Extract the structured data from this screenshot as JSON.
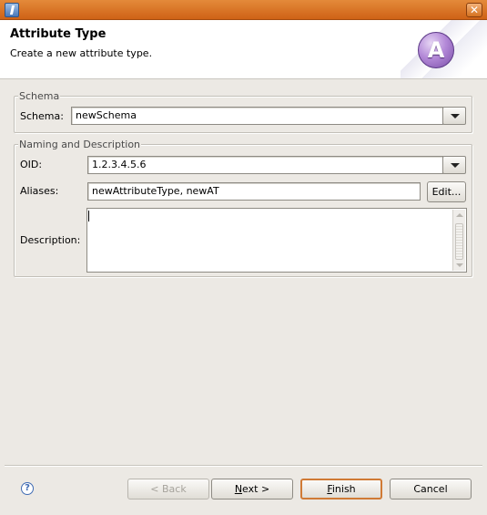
{
  "window": {
    "close_glyph": "✕"
  },
  "header": {
    "title": "Attribute Type",
    "description": "Create a new attribute type.",
    "badge_letter": "A"
  },
  "schema_group": {
    "legend": "Schema",
    "schema_label": "Schema:",
    "schema_value": "newSchema"
  },
  "naming_group": {
    "legend": "Naming and Description",
    "oid_label": "OID:",
    "oid_value": "1.2.3.4.5.6",
    "aliases_label": "Aliases:",
    "aliases_value": "newAttributeType, newAT",
    "edit_label": "Edit...",
    "description_label": "Description:",
    "description_value": ""
  },
  "footer": {
    "help_glyph": "?",
    "back_label": "< Back",
    "back_mnemonic": "B",
    "next_label": "Next >",
    "next_mnemonic": "N",
    "finish_label": "Finish",
    "finish_mnemonic": "F",
    "cancel_label": "Cancel"
  },
  "icons": {
    "app": "eclipse-app-icon",
    "close": "close-icon",
    "badge": "attribute-type-badge-icon",
    "help": "help-icon"
  },
  "colors": {
    "titlebar": "#d56a1d",
    "default_button_border": "#d07a35",
    "badge": "#9b6cc6",
    "dialog_background": "#ece9e4"
  }
}
